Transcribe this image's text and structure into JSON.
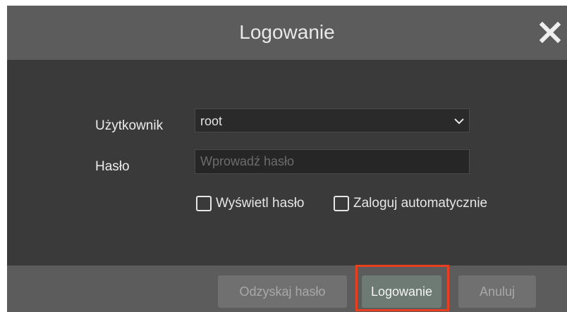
{
  "dialog": {
    "title": "Logowanie",
    "close_icon": "close-icon"
  },
  "form": {
    "user_label": "Użytkownik",
    "user_value": "root",
    "password_label": "Hasło",
    "password_placeholder": "Wprowadź hasło",
    "password_value": "",
    "show_password_label": "Wyświetl hasło",
    "show_password_checked": false,
    "auto_login_label": "Zaloguj automatycznie",
    "auto_login_checked": false
  },
  "footer": {
    "recover_label": "Odzyskaj hasło",
    "login_label": "Logowanie",
    "cancel_label": "Anuluj"
  },
  "colors": {
    "highlight": "#e8401e",
    "titlebar": "#5c5c5c",
    "body": "#3a3a3a",
    "login_button": "#6d7b74"
  }
}
